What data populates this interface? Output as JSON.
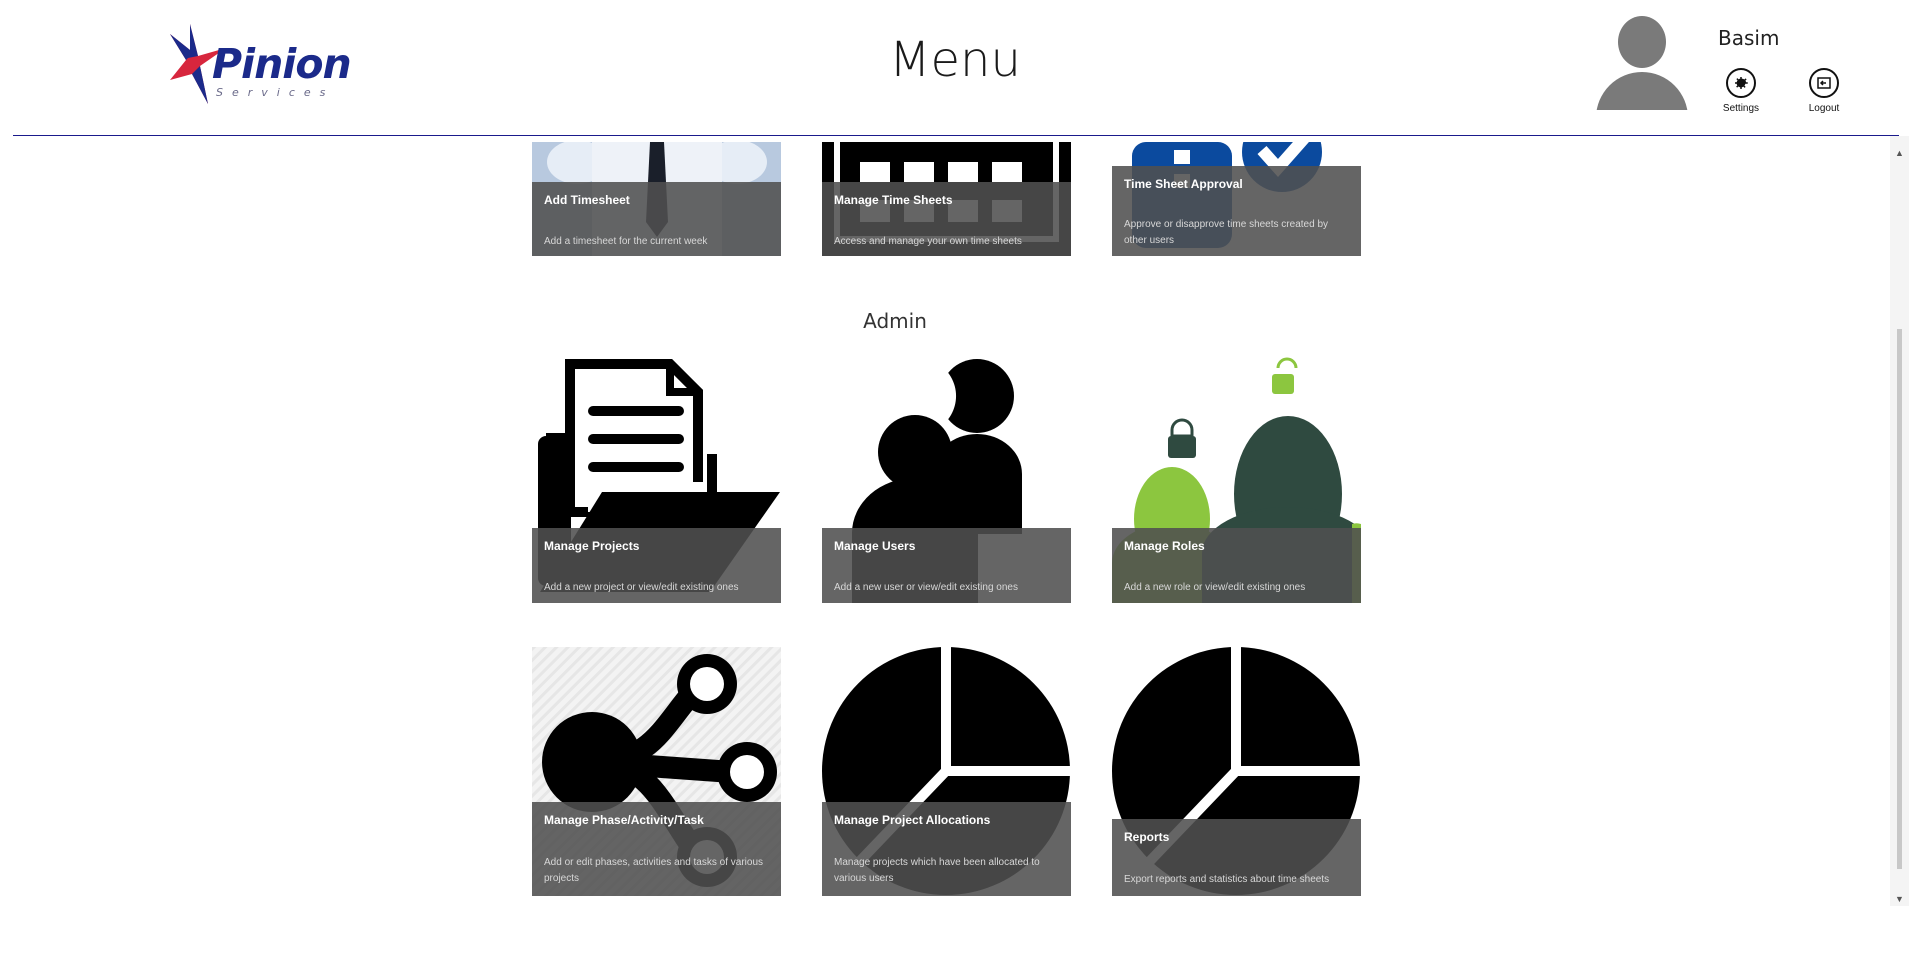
{
  "header": {
    "logo_text": "Pinion",
    "logo_sub": "Services",
    "title": "Menu",
    "username": "Basim",
    "settings_label": "Settings",
    "logout_label": "Logout"
  },
  "timesheets": [
    {
      "title": "Add Timesheet",
      "desc": "Add a timesheet for the current week",
      "icon": "businessman-photo"
    },
    {
      "title": "Manage Time Sheets",
      "desc": "Access and manage your own time sheets",
      "icon": "calendar-icon"
    },
    {
      "title": "Time Sheet Approval",
      "desc": "Approve or disapprove time sheets created by other users",
      "icon": "checklist-icon"
    }
  ],
  "admin": {
    "section_title": "Admin",
    "tiles": [
      {
        "title": "Manage Projects",
        "desc": "Add a new project or view/edit existing ones",
        "icon": "folder-icon"
      },
      {
        "title": "Manage Users",
        "desc": "Add a new user or view/edit existing ones",
        "icon": "users-icon"
      },
      {
        "title": "Manage Roles",
        "desc": "Add a new role or view/edit existing ones",
        "icon": "roles-icon"
      },
      {
        "title": "Manage Phase/Activity/Task",
        "desc": "Add or edit phases, activities and tasks of various projects",
        "icon": "share-icon"
      },
      {
        "title": "Manage Project Allocations",
        "desc": "Manage projects which have been allocated to various users",
        "icon": "pie-chart-icon"
      },
      {
        "title": "Reports",
        "desc": "Export reports and statistics about time sheets",
        "icon": "pie-chart-icon"
      }
    ]
  },
  "colors": {
    "accent": "#1a1a8c",
    "overlay": "#505050",
    "role_green": "#8cc63f",
    "role_dark": "#2f4a40",
    "approval_blue": "#0b4a9e"
  }
}
